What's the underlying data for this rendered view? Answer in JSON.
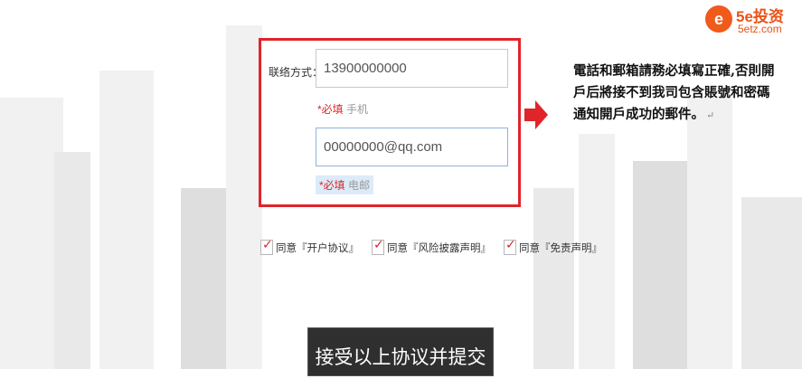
{
  "logo": {
    "mark": "e",
    "brand": "5e投资",
    "url": "5etz.com"
  },
  "form": {
    "contact_label": "联络方式：",
    "phone_value": "13900000000",
    "phone_hint_required": "*必填",
    "phone_hint_text": "手机",
    "email_value": "00000000@qq.com",
    "email_hint_required": "*必填",
    "email_hint_text": "电邮"
  },
  "note": {
    "text": "電話和郵箱請務必填寫正確,否則開戶后將接不到我司包含賬號和密碼通知開戶成功的郵件。",
    "return_mark": "↵"
  },
  "agreements": [
    {
      "checked": true,
      "label": "同意『开户协议』"
    },
    {
      "checked": true,
      "label": "同意『风险披露声明』"
    },
    {
      "checked": true,
      "label": "同意『免责声明』"
    }
  ],
  "submit": {
    "label": "接受以上协议并提交"
  },
  "colors": {
    "accent_red": "#e0242a",
    "brand_orange": "#f05a1a"
  }
}
